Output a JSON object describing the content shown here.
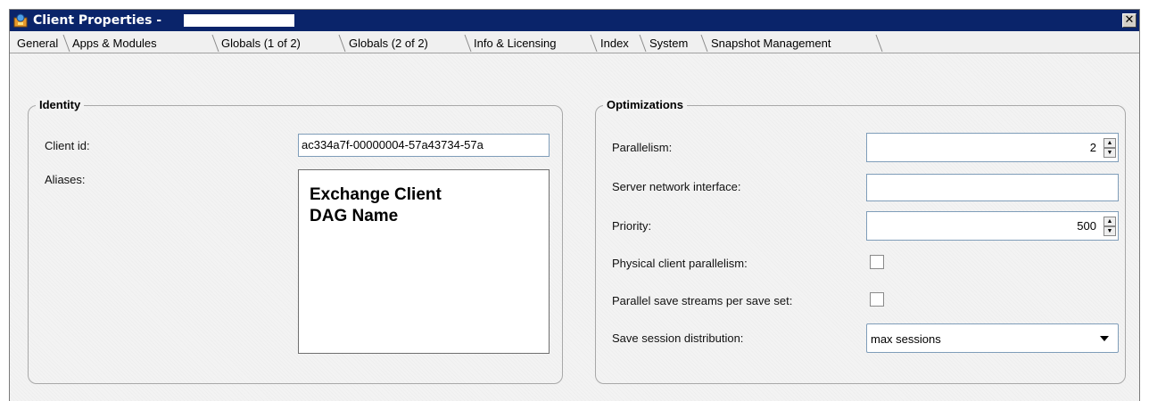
{
  "window": {
    "title": "Client Properties -",
    "close_glyph": "✕"
  },
  "tabs": [
    {
      "label": "General",
      "active": false
    },
    {
      "label": "Apps & Modules",
      "active": false
    },
    {
      "label": "Globals (1 of 2)",
      "active": true
    },
    {
      "label": "Globals (2 of 2)",
      "active": false
    },
    {
      "label": "Info & Licensing",
      "active": false
    },
    {
      "label": "Index",
      "active": false
    },
    {
      "label": "System",
      "active": false
    },
    {
      "label": "Snapshot Management",
      "active": false
    }
  ],
  "identity": {
    "title": "Identity",
    "client_id_label": "Client id:",
    "client_id_value": "ac334a7f-00000004-57a43734-57a",
    "aliases_label": "Aliases:",
    "aliases_value_line1": "Exchange Client",
    "aliases_value_line2": "DAG Name"
  },
  "optimizations": {
    "title": "Optimizations",
    "parallelism_label": "Parallelism:",
    "parallelism_value": "2",
    "server_network_interface_label": "Server network interface:",
    "server_network_interface_value": "",
    "priority_label": "Priority:",
    "priority_value": "500",
    "physical_client_parallelism_label": "Physical client parallelism:",
    "physical_client_parallelism_checked": false,
    "parallel_save_streams_label": "Parallel save streams per save set:",
    "parallel_save_streams_checked": false,
    "save_session_distribution_label": "Save session distribution:",
    "save_session_distribution_value": "max sessions"
  }
}
